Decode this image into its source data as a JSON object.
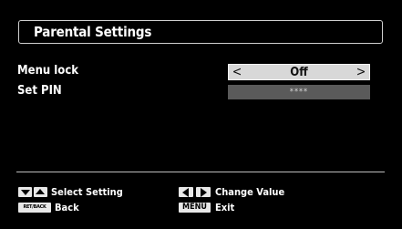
{
  "title": "Parental Settings",
  "settings": [
    {
      "label": "Menu lock",
      "value": "Off"
    },
    {
      "label": "Set PIN",
      "value": "****"
    }
  ],
  "footer": {
    "select_setting": "Select Setting",
    "change_value": "Change Value",
    "back_key": "RET/BACK",
    "back": "Back",
    "menu_key": "MENU",
    "exit": "Exit"
  },
  "colors": {
    "background": "#000000",
    "selected_value_bg": "#d8d8d8",
    "unselected_value_bg": "#5a5a5a",
    "text": "#ffffff"
  }
}
